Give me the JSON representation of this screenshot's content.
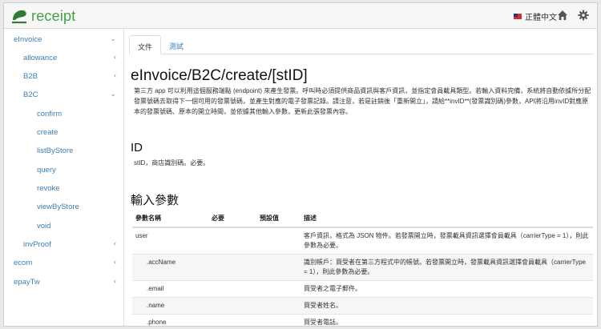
{
  "header": {
    "logo_text": "receipt",
    "language": "正體中文",
    "colors": {
      "brand": "#43a047",
      "link": "#3b7fb6"
    },
    "icons": [
      "logo-icon",
      "flag-icon",
      "home-icon",
      "gear-icon"
    ]
  },
  "sidebar": {
    "items": [
      {
        "label": "eInvoice",
        "chevron": "⌄"
      },
      {
        "label": "allowance",
        "chevron": "‹"
      },
      {
        "label": "B2B",
        "chevron": "‹"
      },
      {
        "label": "B2C",
        "chevron": "⌄"
      },
      {
        "label": "confirm"
      },
      {
        "label": "create"
      },
      {
        "label": "listByStore"
      },
      {
        "label": "query"
      },
      {
        "label": "revoke"
      },
      {
        "label": "viewByStore"
      },
      {
        "label": "void"
      },
      {
        "label": "invProof",
        "chevron": "‹"
      },
      {
        "label": "ecom",
        "chevron": "‹"
      },
      {
        "label": "epayTw",
        "chevron": "‹"
      }
    ]
  },
  "main": {
    "tabs": [
      {
        "label": "文件"
      },
      {
        "label": "測試"
      }
    ],
    "title": "eInvoice/B2C/create/[stID]",
    "description": "第三方 app 可以利用這個服務端點 (endpoint) 來產生發票。呼叫時必須提供商品資訊與客戶資訊，並指定會員載具類型。若輸入資料完備，系統將自動依據所分配發票號碼去取得下一個可用的發票號碼，並產生對應的電子發票記錄。請注意，若是註銷後「重新開立」，請給**invID**(發票識別碼)參數，API將沿用invID對應原本的發票號碼、原本的開立時間，並依據其他輸入參數，更新此張發票內容。",
    "id_section": {
      "heading": "ID",
      "text": "stID，商店識別碼。必要。"
    },
    "input_section": {
      "heading": "輸入參數",
      "columns": [
        "參數名稱",
        "必要",
        "預設值",
        "描述"
      ],
      "rows": [
        {
          "name": "user",
          "required": "",
          "default": "",
          "desc": "客戶資訊，格式為 JSON 物件。若發票開立時，發票載具資訊選擇會員載具（carrierType = 1），則此參數為必要。"
        },
        {
          "name": ".accName",
          "required": "",
          "default": "",
          "desc": "識別帳戶：買受者在第三方程式中的帳號。若發票開立時，發票載具資訊選擇會員載具（carrierType = 1），則此參數為必要。"
        },
        {
          "name": ".email",
          "required": "",
          "default": "",
          "desc": "買受者之電子郵件。"
        },
        {
          "name": ".name",
          "required": "",
          "default": "",
          "desc": "買受者姓名。"
        },
        {
          "name": ".phone",
          "required": "",
          "default": "",
          "desc": "買受者電話。"
        }
      ]
    }
  }
}
